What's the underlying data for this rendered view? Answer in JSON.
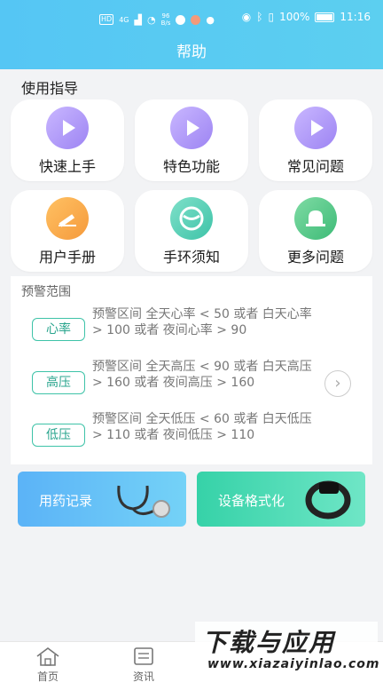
{
  "status_bar": {
    "net_chip": "HD",
    "net_gen": "4G",
    "speed_value": "96",
    "speed_unit": "B/s",
    "battery": "100%",
    "time": "11:16"
  },
  "header": {
    "title": "帮助"
  },
  "guide": {
    "title": "使用指导",
    "tiles": [
      {
        "label": "快速上手",
        "icon": "play-icon"
      },
      {
        "label": "特色功能",
        "icon": "play-icon"
      },
      {
        "label": "常见问题",
        "icon": "play-icon"
      },
      {
        "label": "用户手册",
        "icon": "pencil-icon"
      },
      {
        "label": "手环须知",
        "icon": "band-icon"
      },
      {
        "label": "更多问题",
        "icon": "bell-icon"
      }
    ]
  },
  "warning": {
    "title": "预警范围",
    "items": [
      {
        "tag": "心率",
        "text": "预警区间  全天心率 < 50 或者 白天心率 > 100 或者 夜间心率 > 90"
      },
      {
        "tag": "高压",
        "text": "预警区间  全天高压 < 90 或者 白天高压 > 160 或者 夜间高压 > 160"
      },
      {
        "tag": "低压",
        "text": "预警区间  全天低压 < 60 或者 白天低压 > 110 或者 夜间低压 > 110"
      }
    ]
  },
  "banners": [
    {
      "label": "用药记录"
    },
    {
      "label": "设备格式化"
    }
  ],
  "tabs": [
    {
      "label": "首页",
      "icon": "home-icon"
    },
    {
      "label": "资讯",
      "icon": "news-icon"
    }
  ],
  "watermark": {
    "big": "下载与应用",
    "small": "www.xiazaiyinlao.com"
  },
  "colors": {
    "header": "#55c6f4",
    "accent_green": "#3ec3a8",
    "purple": "#9d84f3"
  }
}
